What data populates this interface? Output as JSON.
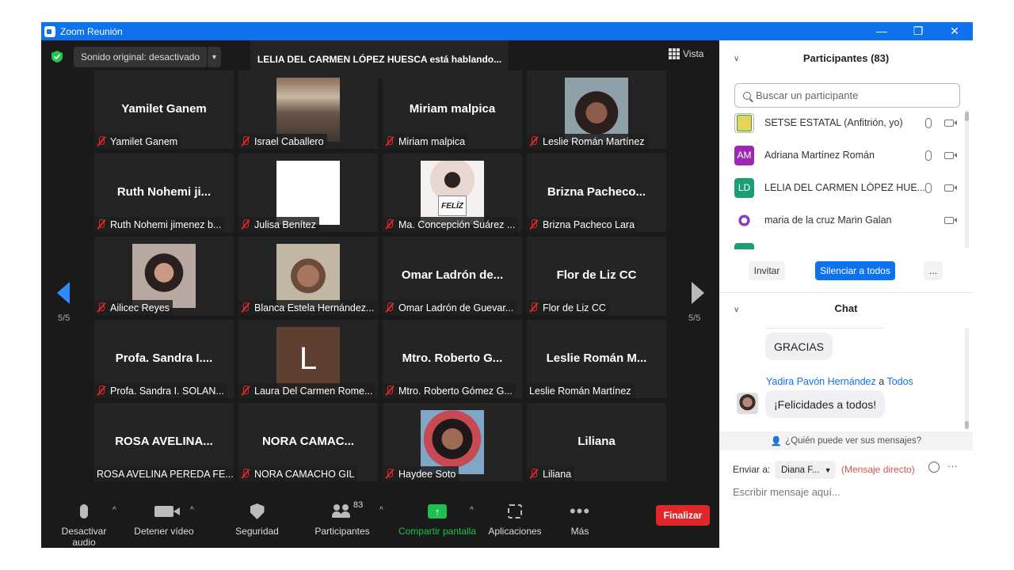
{
  "window": {
    "title": "Zoom Reunión",
    "controls": {
      "minimize": "—",
      "restore": "❐",
      "close": "✕"
    }
  },
  "top_bar": {
    "sound_button": "Sonido original: desactivado",
    "dropdown_arrow": "▼",
    "speaking_banner": "LELIA DEL CARMEN LÓPEZ HUESCA está hablando...",
    "view_label": "Vista"
  },
  "pagination": {
    "left": "5/5",
    "right": "5/5"
  },
  "tiles": [
    {
      "display_name": "Yamilet Ganem",
      "caption": "Yamilet Ganem",
      "muted": true,
      "photo": "none"
    },
    {
      "display_name": "",
      "caption": "Israel Caballero",
      "muted": true,
      "photo": "classroom"
    },
    {
      "display_name": "Miriam malpica",
      "caption": "Miriam malpica",
      "muted": true,
      "photo": "none"
    },
    {
      "display_name": "",
      "caption": "Leslie Román Martínez",
      "muted": true,
      "photo": "portrait-leslie"
    },
    {
      "display_name": "Ruth Nohemi ji...",
      "caption": "Ruth Nohemi jimenez b...",
      "muted": true,
      "photo": "none"
    },
    {
      "display_name": "",
      "caption": "Julisa Benítez",
      "muted": true,
      "photo": "white"
    },
    {
      "display_name": "",
      "caption": "Ma. Concepción Suárez ...",
      "muted": true,
      "photo": "feliz",
      "photo_text": "FELÍZ"
    },
    {
      "display_name": "Brizna  Pacheco...",
      "caption": "Brizna Pacheco Lara",
      "muted": true,
      "photo": "none"
    },
    {
      "display_name": "",
      "caption": "Ailicec Reyes",
      "muted": true,
      "photo": "portrait-ailicec"
    },
    {
      "display_name": "",
      "caption": "Blanca Estela Hernández...",
      "muted": true,
      "photo": "portrait-blanca"
    },
    {
      "display_name": "Omar Ladrón de...",
      "caption": "Omar Ladrón de Guevar...",
      "muted": true,
      "photo": "none"
    },
    {
      "display_name": "Flor de Liz CC",
      "caption": "Flor de Liz CC",
      "muted": true,
      "photo": "none"
    },
    {
      "display_name": "Profa. Sandra I....",
      "caption": "Profa. Sandra I. SOLAN...",
      "muted": true,
      "photo": "none"
    },
    {
      "display_name": "",
      "caption": "Laura Del Carmen Rome...",
      "muted": true,
      "photo": "letter",
      "photo_text": "L"
    },
    {
      "display_name": "Mtro. Roberto G...",
      "caption": "Mtro. Roberto Gómez G...",
      "muted": true,
      "photo": "none"
    },
    {
      "display_name": "Leslie Román M...",
      "caption": "Leslie Román Martínez",
      "muted": false,
      "photo": "none"
    },
    {
      "display_name": "ROSA AVELINA...",
      "caption": "ROSA AVELINA PEREDA FE...",
      "muted": false,
      "photo": "none"
    },
    {
      "display_name": "NORA  CAMAC...",
      "caption": "NORA  CAMACHO GIL",
      "muted": true,
      "photo": "none"
    },
    {
      "display_name": "",
      "caption": "Haydee Soto",
      "muted": true,
      "photo": "portrait-haydee"
    },
    {
      "display_name": "Liliana",
      "caption": "Liliana",
      "muted": true,
      "photo": "none"
    }
  ],
  "toolbar": {
    "mute_audio": "Desactivar audio",
    "stop_video": "Detener vídeo",
    "security": "Seguridad",
    "participants": "Participantes",
    "participants_count": "83",
    "share_screen": "Compartir pantalla",
    "apps": "Aplicaciones",
    "more": "Más",
    "end": "Finalizar",
    "caret": "^"
  },
  "participants_panel": {
    "header": "Participantes (83)",
    "search_placeholder": "Buscar un participante",
    "list": [
      {
        "name": "SETSE ESTATAL (Anfitrión, yo)",
        "avatar": "",
        "mic": true
      },
      {
        "name": "Adriana Martínez Román",
        "avatar": "AM",
        "mic": true
      },
      {
        "name": "LELIA DEL CARMEN LÓPEZ HUE...",
        "avatar": "LD",
        "mic": true
      },
      {
        "name": "maria de la cruz Marin Galan",
        "avatar": "",
        "mic": false
      }
    ],
    "invite": "Invitar",
    "mute_all": "Silenciar a todos",
    "more": "..."
  },
  "chat": {
    "header": "Chat",
    "messages": [
      {
        "text": "GRACIAS"
      },
      {
        "sender": "Yadira Pavón Hernández",
        "connector": "a",
        "recipient": "Todos",
        "text": "¡Felicidades a todos!"
      }
    ],
    "visibility": "¿Quién puede ver sus mensajes?",
    "send_to_label": "Enviar a:",
    "send_to_value": "Diana F...",
    "direct_label": "(Mensaje directo)",
    "compose_placeholder": "Escribir mensaje aquí...",
    "more": "···"
  },
  "colors": {
    "accent": "#0e72ed",
    "muted_red": "#e02828",
    "share_green": "#1ec04f",
    "tile_bg": "#242424"
  }
}
